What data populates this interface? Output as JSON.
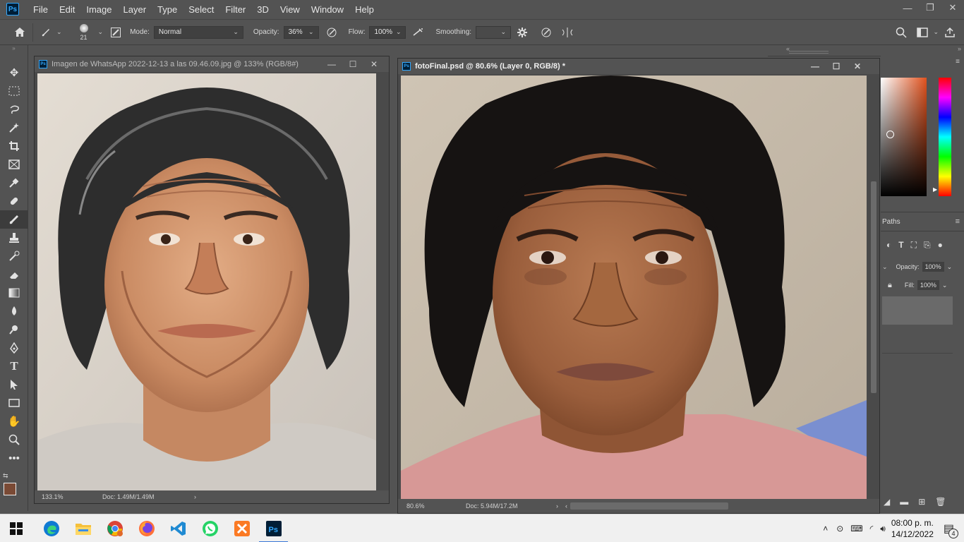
{
  "menubar": {
    "logo": "Ps",
    "items": [
      "File",
      "Edit",
      "Image",
      "Layer",
      "Type",
      "Select",
      "Filter",
      "3D",
      "View",
      "Window",
      "Help"
    ]
  },
  "options": {
    "brush_size": "21",
    "mode_label": "Mode:",
    "mode_value": "Normal",
    "opacity_label": "Opacity:",
    "opacity_value": "36%",
    "flow_label": "Flow:",
    "flow_value": "100%",
    "smoothing_label": "Smoothing:"
  },
  "doc1": {
    "title": "Imagen de WhatsApp 2022-12-13 a las 09.46.09.jpg @ 133% (RGB/8#)",
    "zoom": "133.1%",
    "docsize": "Doc: 1.49M/1.49M"
  },
  "doc2": {
    "title": "fotoFinal.psd @ 80.6% (Layer 0, RGB/8) *",
    "zoom": "80.6%",
    "docsize": "Doc: 5.94M/17.2M"
  },
  "panels": {
    "paths_tab": "Paths",
    "opacity_label": "Opacity:",
    "opacity_value": "100%",
    "fill_label": "Fill:",
    "fill_value": "100%"
  },
  "taskbar": {
    "time": "08:00 p. m.",
    "date": "14/12/2022",
    "notifications": "4"
  },
  "colors": {
    "foreground": "#7a4a35",
    "background": "#ffffff",
    "ui_bg": "#535353"
  }
}
